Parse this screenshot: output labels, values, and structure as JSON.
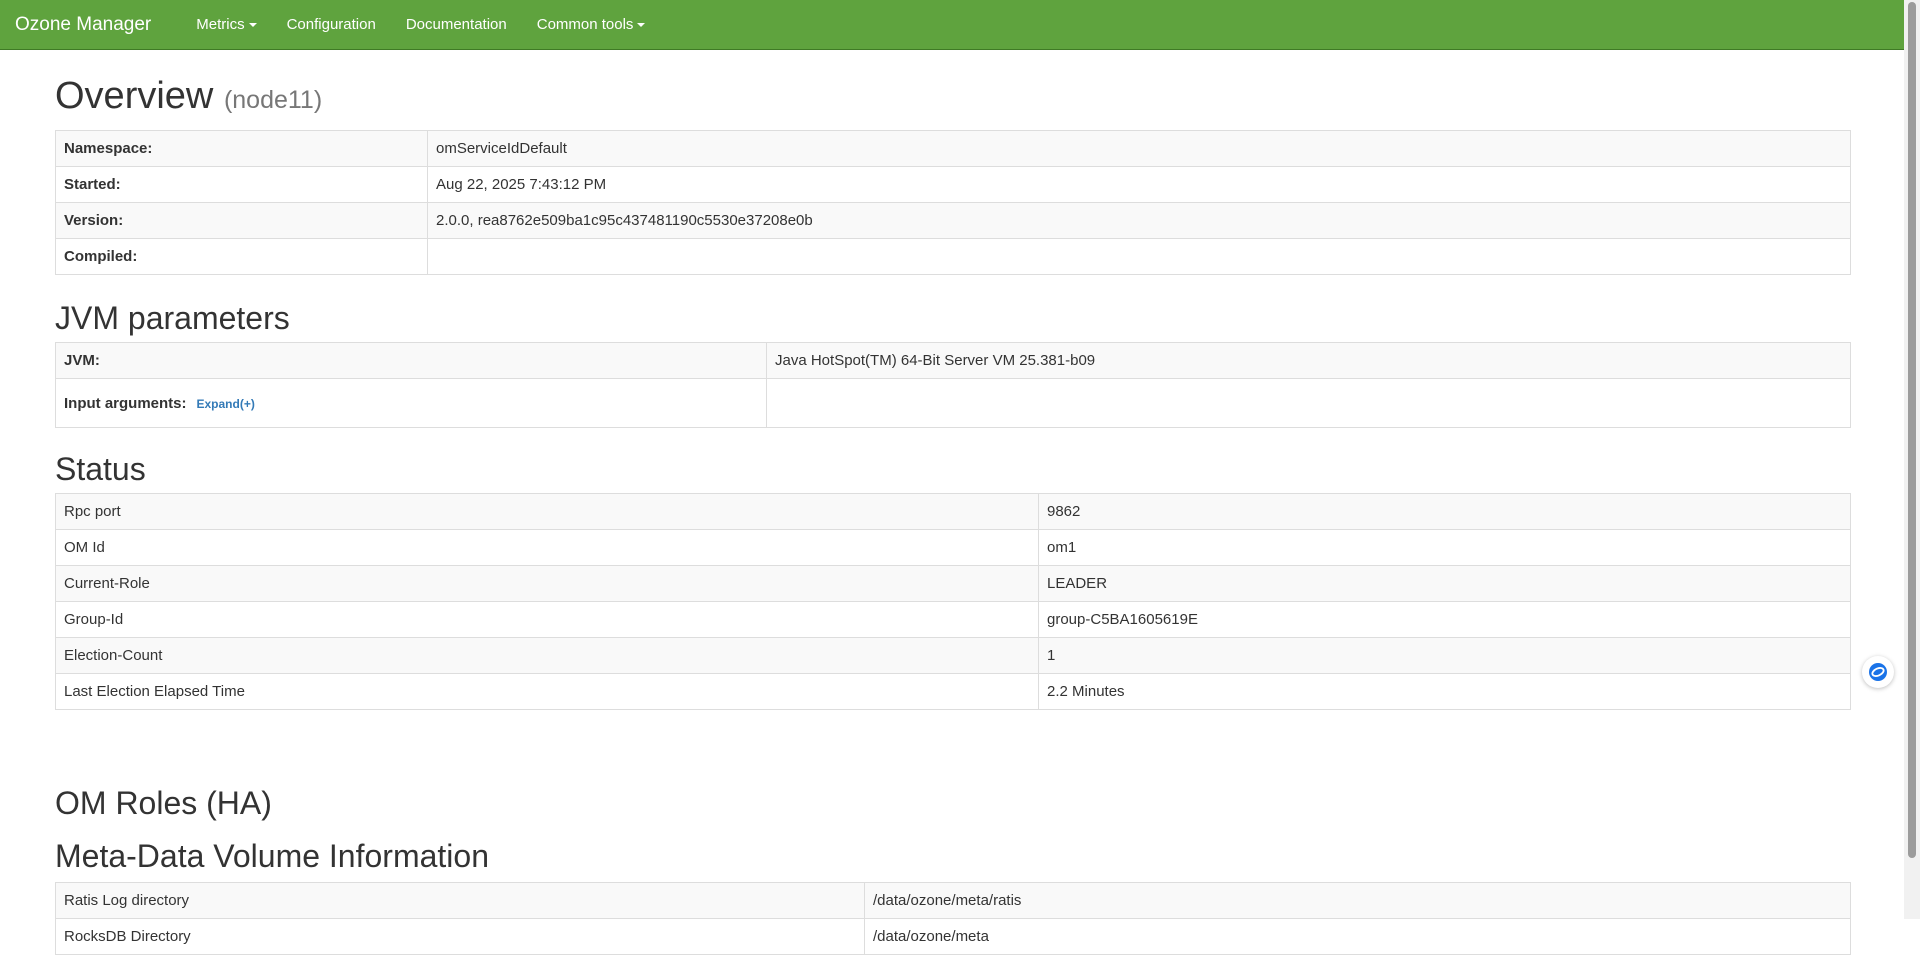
{
  "navbar": {
    "brand": "Ozone Manager",
    "items": [
      {
        "label": "Metrics",
        "dropdown": true
      },
      {
        "label": "Configuration",
        "dropdown": false
      },
      {
        "label": "Documentation",
        "dropdown": false
      },
      {
        "label": "Common tools",
        "dropdown": true
      }
    ],
    "color": "#5fa33e"
  },
  "overview": {
    "title": "Overview",
    "node": "(node11)",
    "rows": [
      {
        "label": "Namespace:",
        "value": "omServiceIdDefault"
      },
      {
        "label": "Started:",
        "value": "Aug 22, 2025 7:43:12 PM"
      },
      {
        "label": "Version:",
        "value": "2.0.0, rea8762e509ba1c95c437481190c5530e37208e0b"
      },
      {
        "label": "Compiled:",
        "value": ""
      }
    ]
  },
  "jvm": {
    "title": "JVM parameters",
    "rows": [
      {
        "label": "JVM:",
        "value": "Java HotSpot(TM) 64-Bit Server VM 25.381-b09"
      },
      {
        "label": "Input arguments:",
        "value": "",
        "link": "Expand(+)"
      }
    ]
  },
  "status": {
    "title": "Status",
    "rows": [
      {
        "label": "Rpc port",
        "value": "9862"
      },
      {
        "label": "OM Id",
        "value": "om1"
      },
      {
        "label": "Current-Role",
        "value": "LEADER"
      },
      {
        "label": "Group-Id",
        "value": "group-C5BA1605619E"
      },
      {
        "label": "Election-Count",
        "value": "1"
      },
      {
        "label": "Last Election Elapsed Time",
        "value": "2.2 Minutes"
      }
    ]
  },
  "om_roles": {
    "title": "OM Roles (HA)"
  },
  "metadata": {
    "title": "Meta-Data Volume Information",
    "rows": [
      {
        "label": "Ratis Log directory",
        "value": "/data/ozone/meta/ratis"
      },
      {
        "label": "RocksDB Directory",
        "value": "/data/ozone/meta"
      }
    ]
  },
  "floating_button": {
    "icon": "assistant-icon"
  }
}
